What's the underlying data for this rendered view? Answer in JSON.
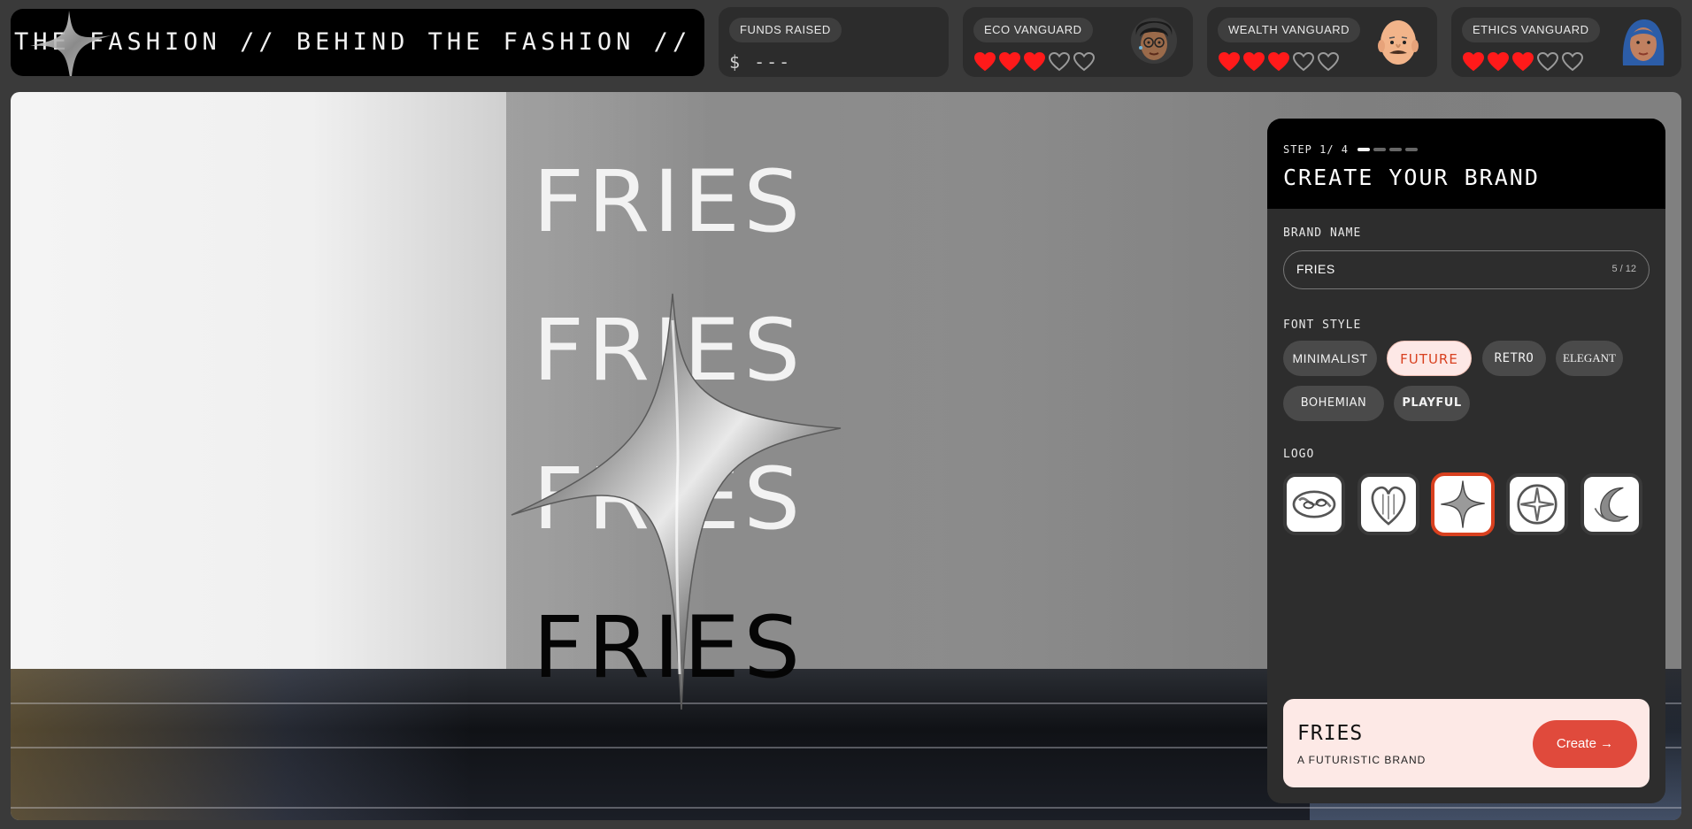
{
  "ticker": {
    "text": "THE FASHION // BEHIND THE FASHION // BEHIND THE FASHION // BEHI"
  },
  "funds": {
    "label": "FUNDS RAISED",
    "value": "$ ---"
  },
  "vanguards": [
    {
      "label": "ECO VANGUARD",
      "hearts_filled": 3,
      "hearts_total": 5,
      "avatar": "eco-avatar"
    },
    {
      "label": "WEALTH VANGUARD",
      "hearts_filled": 3,
      "hearts_total": 5,
      "avatar": "wealth-avatar"
    },
    {
      "label": "ETHICS VANGUARD",
      "hearts_filled": 3,
      "hearts_total": 5,
      "avatar": "ethics-avatar"
    }
  ],
  "stage": {
    "brand_words": [
      "FRIES",
      "FRIES",
      "FRIES",
      "FRIES"
    ]
  },
  "panel": {
    "step_label": "STEP 1/ 4",
    "step_current": 1,
    "step_total": 4,
    "title": "CREATE YOUR BRAND",
    "brand_name_label": "BRAND NAME",
    "brand_name_value": "FRIES",
    "brand_name_count": "5 / 12",
    "font_style_label": "FONT STYLE",
    "font_styles": [
      "MINIMALIST",
      "FUTURE",
      "RETRO",
      "ELEGANT",
      "BOHEMIAN",
      "PLAYFUL"
    ],
    "selected_font_style": "FUTURE",
    "logo_label": "LOGO",
    "logos": [
      "swirl-logo-icon",
      "heart-logo-icon",
      "star-logo-icon",
      "flower-logo-icon",
      "crescent-logo-icon"
    ],
    "selected_logo": "star-logo-icon",
    "summary_name": "FRIES",
    "summary_tagline": "A FUTURISTIC BRAND",
    "create_label": "Create →"
  },
  "colors": {
    "accent": "#e04a3c",
    "selected_chip_bg": "#fde8e6",
    "heart_red": "#ff1a1a"
  }
}
